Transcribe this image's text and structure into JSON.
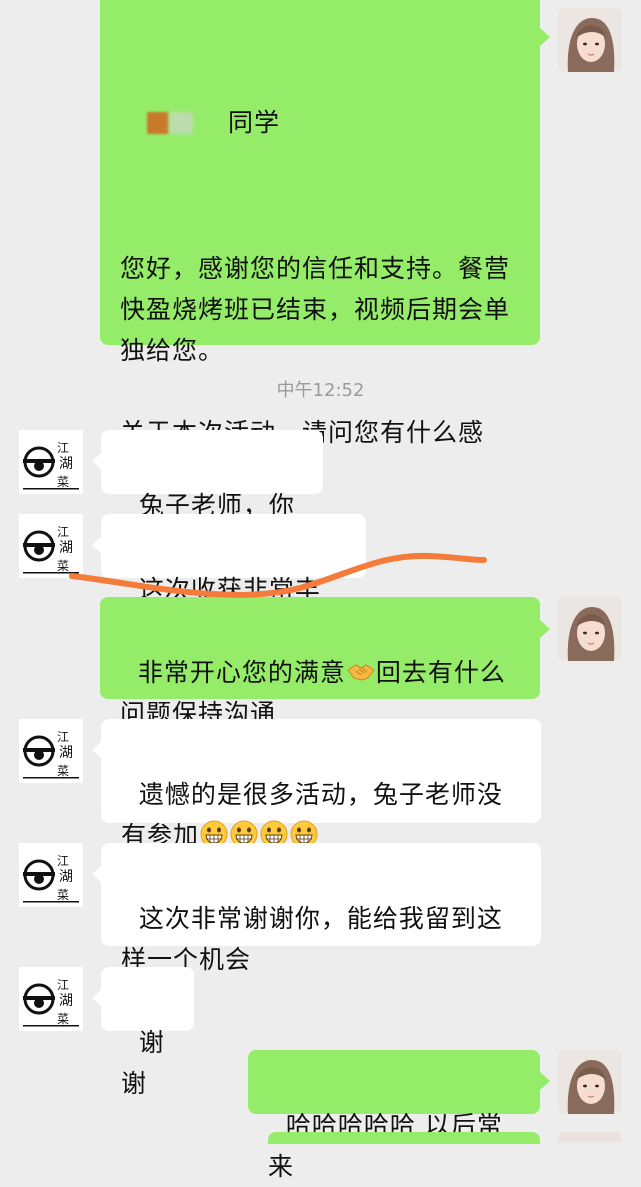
{
  "messages": {
    "m1_sender": "同学",
    "m1_text": "您好，感谢您的信任和支持。餐营快盈烧烤班已结束，视频后期会单独给您。\n\n关于本次活动，请问您有什么感想、收获或建议？",
    "timestamp": "中午12:52",
    "m2_text": "兔子老师，你好",
    "m3_text": "这次收获非常丰富，",
    "m4_text_a": "非常开心您的满意",
    "m4_emoji": "handshake",
    "m4_text_b": "回去有什么问题保持沟通",
    "m5_text": "遗憾的是很多活动，兔子老师没有参加",
    "m5_emoji": "grinning-face x4",
    "m6_text": "这次非常谢谢你，能给我留到这样一个机会",
    "m7_text": "谢谢",
    "m8_text": "哈哈哈哈哈 以后常来"
  },
  "avatars": {
    "logo_text": "江湖菜"
  },
  "colors": {
    "outgoing_bubble": "#95ec69",
    "incoming_bubble": "#ffffff",
    "background": "#ededed",
    "annotation_stroke": "#f47b3a"
  }
}
